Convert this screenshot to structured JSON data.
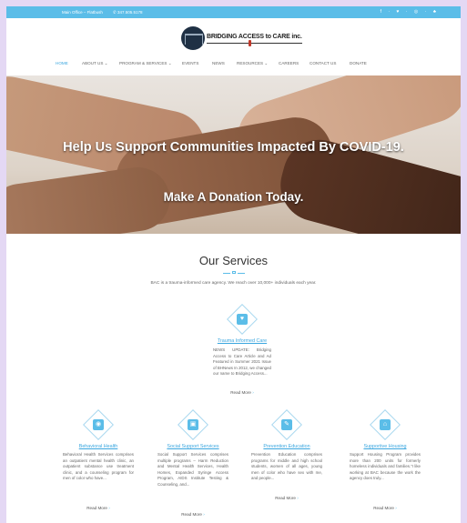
{
  "topbar": {
    "office": "Main Office – Flatbush",
    "phone": "347.505.5178",
    "social": "f · ♥ · ◎ · ♣"
  },
  "logo": {
    "name": "BRIDGING ACCESS to CARE inc."
  },
  "nav": {
    "items": [
      "HOME",
      "ABOUT US ⌄",
      "PROGRAM & SERVICES ⌄",
      "EVENTS",
      "NEWS",
      "RESOURCES ⌄",
      "CAREERS",
      "CONTACT US",
      "DONATE"
    ]
  },
  "hero": {
    "headline": "Help Us Support Communities Impacted By COVID-19.",
    "sub": "Make A Donation Today."
  },
  "services": {
    "title": "Our Services",
    "description": "BAC is a trauma-informed care agency. We reach over 10,000+ individuals each year.",
    "cards": [
      {
        "title": "Trauma Informed Care",
        "icon": "heart-icon",
        "glyph": "♥",
        "body": "NEWS UPDATE: Bridging Access to Care Article and Ad Featured in Summer 2021 Issue of BHNews In 2012, we changed our name to Bridging Access...",
        "more": "Read More"
      },
      {
        "title": "Behavioral Health",
        "icon": "camera-icon",
        "glyph": "◉",
        "body": "Behavioral Health Services comprises an outpatient mental health clinic, an outpatient substance use treatment clinic, and a counseling program for men of color who have...",
        "more": "Read More"
      },
      {
        "title": "Social Support Services",
        "icon": "image-icon",
        "glyph": "▣",
        "body": "Social Support Services comprises multiple programs – Harm Reduction and Mental Health Services, Health Homes, Expanded Syringe Access Program, AIDS Institute Testing & Counseling, and...",
        "more": "Read More"
      },
      {
        "title": "Prevention Education",
        "icon": "edit-icon",
        "glyph": "✎",
        "body": "Prevention Education comprises programs for middle and high school students, women of all ages, young men of color who have sex with me, and people...",
        "more": "Read More"
      },
      {
        "title": "Supportive Housing",
        "icon": "home-icon",
        "glyph": "⌂",
        "body": "Support Housing Program provides more than 200 units for formerly homeless individuals and families.“I like working at BAC because the work the agency does truly...",
        "more": "Read More"
      }
    ]
  },
  "colors": {
    "accent": "#5bbde8",
    "link": "#3aa6df",
    "frame": "#e4d8f4"
  }
}
